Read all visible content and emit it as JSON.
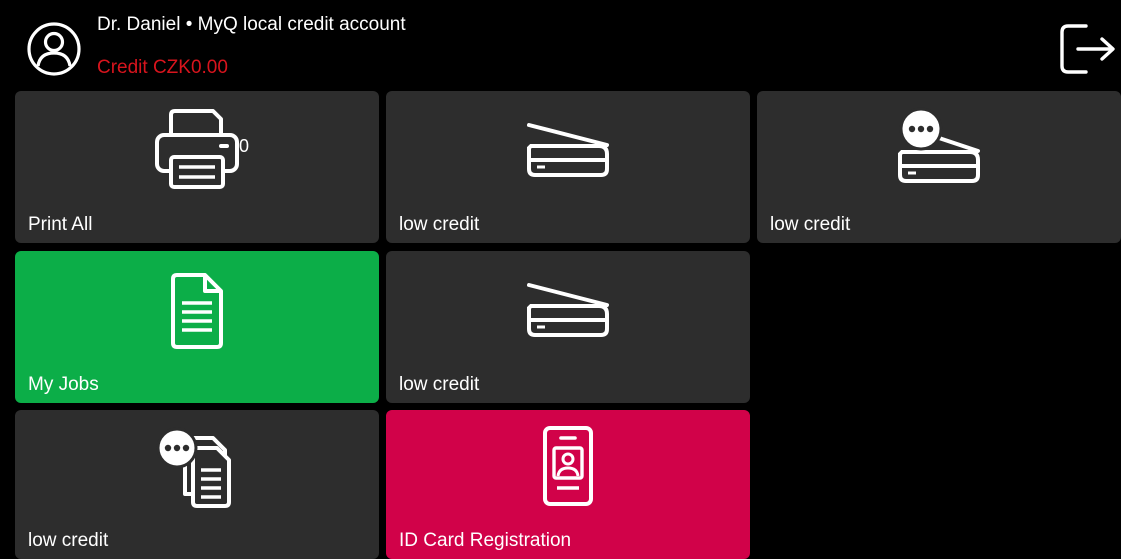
{
  "header": {
    "user_line": "Dr. Daniel • MyQ local credit account",
    "credit_line": "Credit CZK0.00",
    "credit_color": "#d8141d",
    "avatar_icon": "user-circle-icon",
    "logout_icon": "logout-icon"
  },
  "tiles": [
    {
      "label": "Print All",
      "icon": "printer-icon",
      "badge": "0"
    },
    {
      "label": "low credit",
      "icon": "scanner-icon"
    },
    {
      "label": "low credit",
      "icon": "scanner-options-icon"
    },
    {
      "label": "My Jobs",
      "icon": "document-icon"
    },
    {
      "label": "low credit",
      "icon": "scanner-icon"
    },
    {
      "label": "low credit",
      "icon": "copy-options-icon"
    },
    {
      "label": "ID Card Registration",
      "icon": "id-card-icon"
    }
  ],
  "colors": {
    "background": "#000000",
    "tile": "#2d2d2d",
    "my_jobs_tile": "#0cae48",
    "id_card_tile": "#d10249",
    "text": "#ffffff"
  }
}
